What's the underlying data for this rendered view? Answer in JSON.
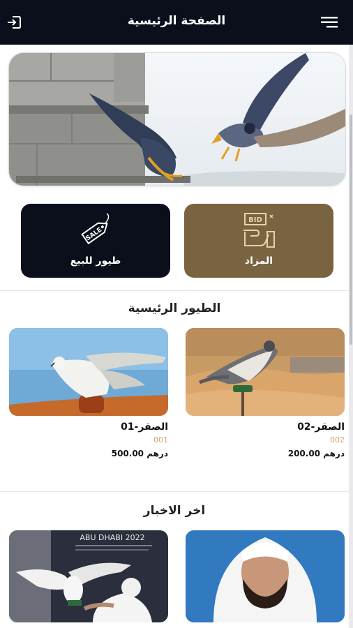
{
  "header": {
    "title": "الصفحة الرئيسية",
    "menu_icon": "menu-icon",
    "logout_icon": "logout-icon"
  },
  "categories": {
    "auction": {
      "label": "المزاد",
      "icon": "bid-hand-icon",
      "badge": "BID",
      "color": "#7a6341"
    },
    "sale": {
      "label": "طيور للبيع",
      "icon": "sale-tag-icon",
      "tag_text": "SALE",
      "color": "#0b0f1c"
    }
  },
  "birds_section": {
    "title": "الطيور الرئيسية",
    "items": [
      {
        "name": "الصقر-02",
        "code": "002",
        "price": "200.00 درهم"
      },
      {
        "name": "الصقر-01",
        "code": "001",
        "price": "500.00 درهم"
      }
    ]
  },
  "news_section": {
    "title": "اخر الاخبار",
    "items": [
      {
        "banner_text": "ABU DHABI 2022"
      }
    ]
  },
  "colors": {
    "header_bg": "#0b0f1c",
    "accent_brown": "#7a6341",
    "code_gold": "#c8a76a"
  }
}
